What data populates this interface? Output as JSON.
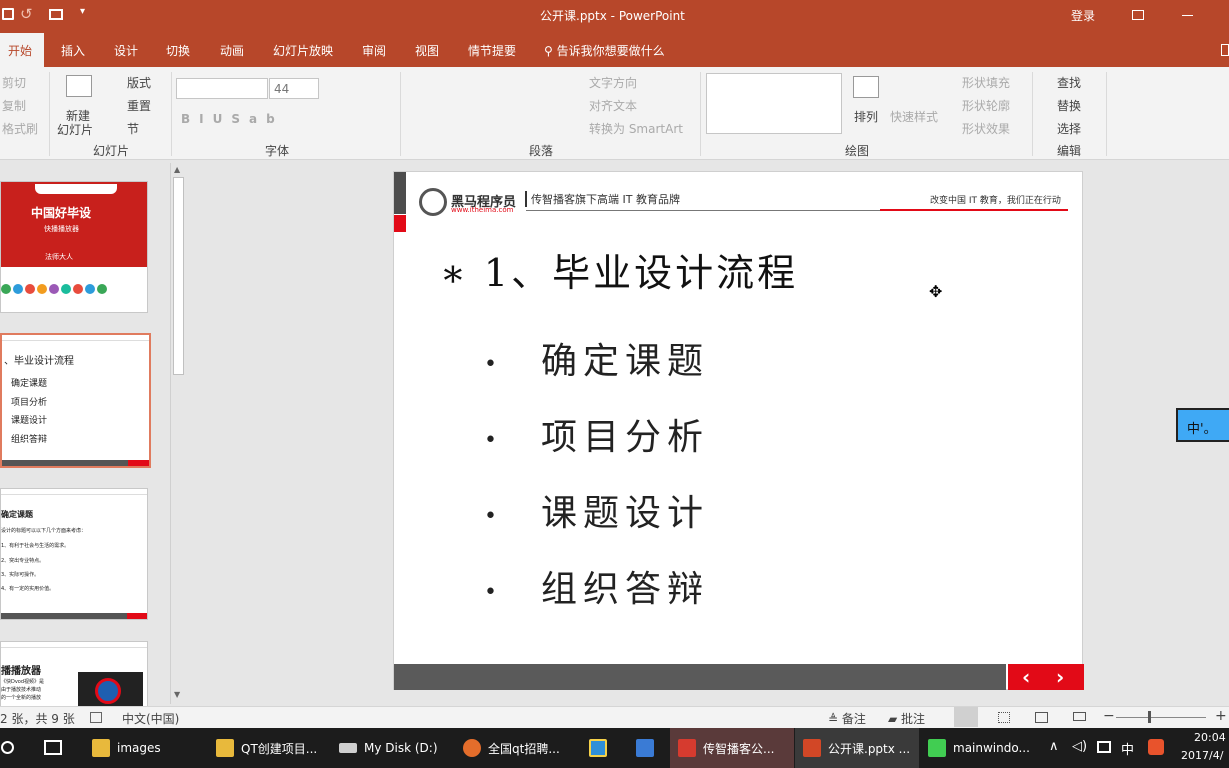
{
  "title_bar": {
    "doc_title": "公开课.pptx - PowerPoint",
    "signin": "登录"
  },
  "tabs": [
    "开始",
    "插入",
    "设计",
    "切换",
    "动画",
    "幻灯片放映",
    "审阅",
    "视图",
    "情节提要"
  ],
  "tell_me": "告诉我你想要做什么",
  "ribbon": {
    "clipboard": {
      "cut": "剪切",
      "copy": "复制",
      "format": "格式刷"
    },
    "slides": {
      "new1": "新建",
      "new2": "幻灯片",
      "layout": "版式",
      "reset": "重置",
      "section": "节",
      "group": "幻灯片"
    },
    "font": {
      "size": "44",
      "group": "字体"
    },
    "paragraph": {
      "direction": "文字方向",
      "align": "对齐文本",
      "smartart": "转换为 SmartArt",
      "group": "段落"
    },
    "drawing": {
      "arrange": "排列",
      "quick": "快速样式",
      "fill": "形状填充",
      "outline": "形状轮廓",
      "effect": "形状效果",
      "group": "绘图"
    },
    "editing": {
      "find": "查找",
      "replace": "替换",
      "select": "选择",
      "group": "编辑"
    }
  },
  "thumbs": {
    "t1": {
      "title": "中国好毕设",
      "sub": "快播播放器",
      "author": "法师大人"
    },
    "t2": {
      "heading": "、毕业设计流程",
      "items": [
        "确定课题",
        "项目分析",
        "课题设计",
        "组织答辩"
      ]
    },
    "t3": {
      "heading": "确定课题",
      "lines": [
        "设计的标题可以以下几个方面来考虑：",
        "1、有利于社会与生活的需求。",
        "2、突出专业特点。",
        "3、实际可操作。",
        "4、有一定的实用价值。"
      ]
    },
    "t4": {
      "heading": "播播放器",
      "lines": [
        "《快Dvod视频》是",
        "由于播放技术推动",
        "的一个全新的播放"
      ]
    }
  },
  "slide": {
    "logo_name": "黑马程序员",
    "logo_url": "www.itheima.com",
    "tagline": "传智播客旗下高端 IT 教育品牌",
    "slogan": "改变中国 IT 教育，我们正在行动",
    "title": "∗ 1、毕业设计流程",
    "bullets": [
      "确定课题",
      "项目分析",
      "课题设计",
      "组织答辩"
    ]
  },
  "ime_text": "中'。",
  "status": {
    "page": "2 张，共 9 张",
    "lang": "中文(中国)",
    "notes": "备注",
    "comments": "批注"
  },
  "taskbar": {
    "items": [
      {
        "label": "images",
        "color": "#e8b93c"
      },
      {
        "label": "QT创建项目...",
        "color": "#e8b93c"
      },
      {
        "label": "My Disk (D:)",
        "color": "#cfcfcf"
      },
      {
        "label": "全国qt招聘...",
        "color": "#e46d2b"
      },
      {
        "label": "",
        "color": "#2f8fd8"
      },
      {
        "label": "",
        "color": "#3a7bd5"
      },
      {
        "label": "传智播客公...",
        "color": "#d63b2f"
      },
      {
        "label": "公开课.pptx ...",
        "color": "#d24726"
      },
      {
        "label": "mainwindo...",
        "color": "#41cd52"
      }
    ],
    "ime": "中",
    "time": "20:04",
    "date": "2017/4/"
  },
  "colors": {
    "accent": "#b7472a",
    "slide_red": "#e20a17",
    "footer_gray": "#5a5a5a"
  }
}
